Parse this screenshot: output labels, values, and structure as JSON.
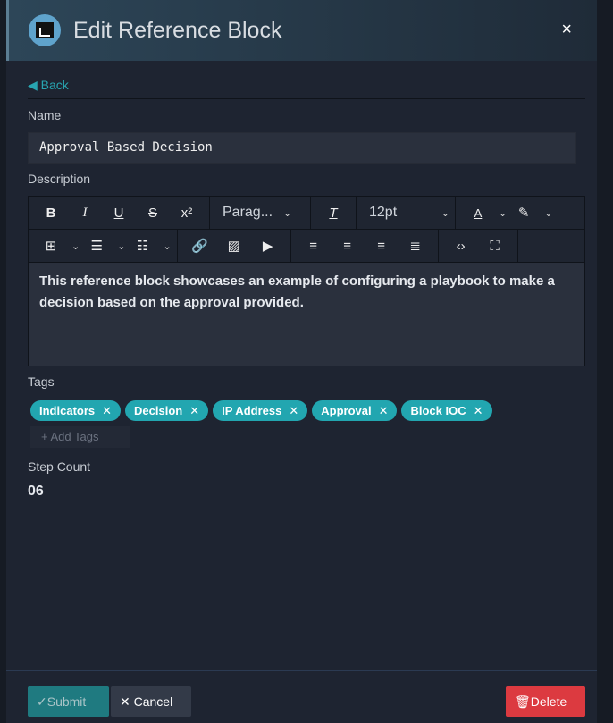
{
  "header": {
    "title": "Edit Reference Block",
    "close": "×"
  },
  "back": "Back",
  "name": {
    "label": "Name",
    "value": "Approval Based Decision"
  },
  "description": {
    "label": "Description",
    "format": "Parag...",
    "font_size": "12pt",
    "text": "This reference block showcases an example of configuring a playbook to make a decision based on the approval provided."
  },
  "tags": {
    "label": "Tags",
    "items": [
      "Indicators",
      "Decision",
      "IP Address",
      "Approval",
      "Block IOC"
    ],
    "add_placeholder": "+ Add Tags"
  },
  "step_count": {
    "label": "Step Count",
    "value": "06"
  },
  "footer": {
    "submit": "Submit",
    "cancel": "Cancel",
    "delete": "Delete"
  }
}
